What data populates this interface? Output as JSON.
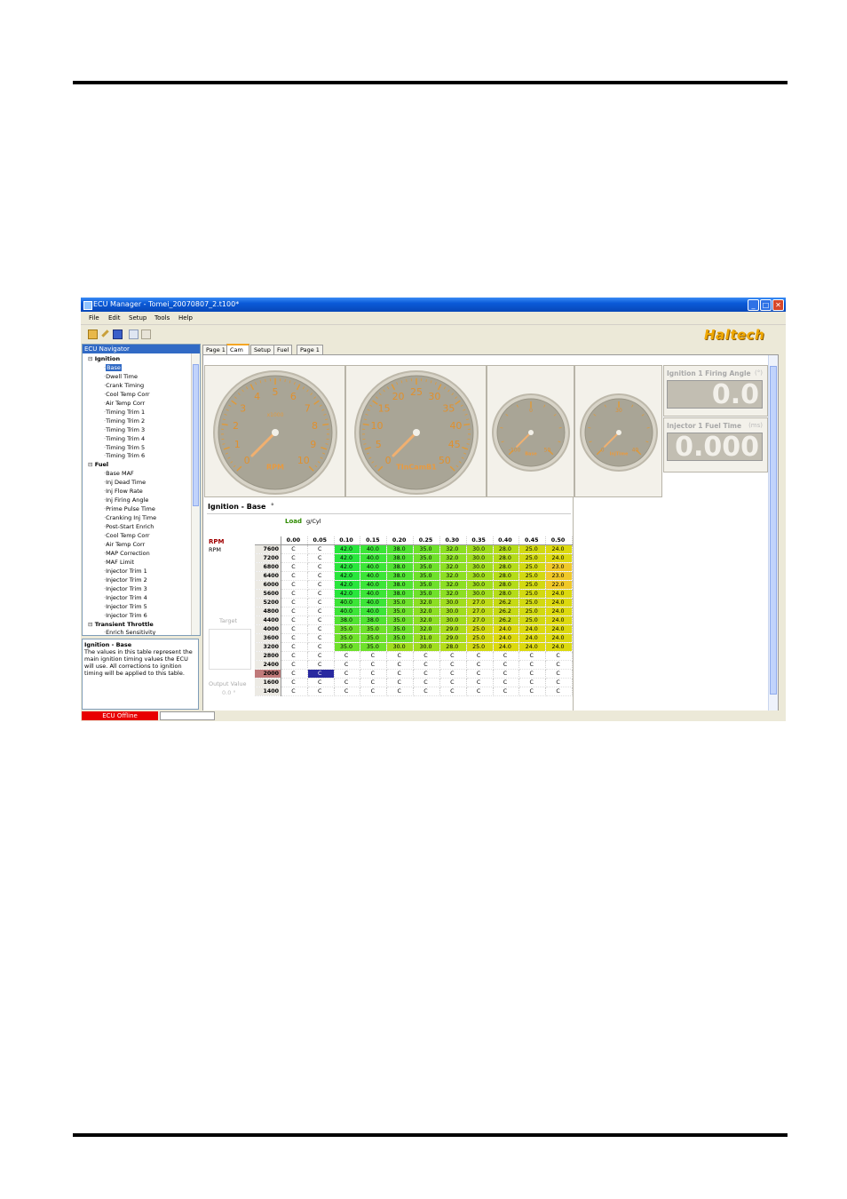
{
  "window": {
    "title": "ECU Manager - Tomei_20070807_2.t100*"
  },
  "menu": [
    "File",
    "Edit",
    "Setup",
    "Tools",
    "Help"
  ],
  "brand": {
    "logo": "Haltech"
  },
  "navigator": {
    "title": "ECU Navigator",
    "items": [
      {
        "label": "Ignition",
        "group": true
      },
      {
        "label": "Base",
        "selected": true
      },
      {
        "label": "Dwell Time"
      },
      {
        "label": "Crank Timing"
      },
      {
        "label": "Cool Temp Corr"
      },
      {
        "label": "Air Temp Corr"
      },
      {
        "label": "Timing Trim 1"
      },
      {
        "label": "Timing Trim 2"
      },
      {
        "label": "Timing Trim 3"
      },
      {
        "label": "Timing Trim 4"
      },
      {
        "label": "Timing Trim 5"
      },
      {
        "label": "Timing Trim 6"
      },
      {
        "label": "Fuel",
        "group": true
      },
      {
        "label": "Base MAF"
      },
      {
        "label": "Inj Dead Time"
      },
      {
        "label": "Inj Flow Rate"
      },
      {
        "label": "Inj Firing Angle"
      },
      {
        "label": "Prime Pulse Time"
      },
      {
        "label": "Cranking Inj Time"
      },
      {
        "label": "Post-Start Enrich"
      },
      {
        "label": "Cool Temp Corr"
      },
      {
        "label": "Air Temp Corr"
      },
      {
        "label": "MAP Correction"
      },
      {
        "label": "MAF Limit"
      },
      {
        "label": "Injector Trim 1"
      },
      {
        "label": "Injector Trim 2"
      },
      {
        "label": "Injector Trim 3"
      },
      {
        "label": "Injector Trim 4"
      },
      {
        "label": "Injector Trim 5"
      },
      {
        "label": "Injector Trim 6"
      },
      {
        "label": "Transient Throttle",
        "group": true
      },
      {
        "label": "Enrich Sensitivity"
      }
    ]
  },
  "description": {
    "title": "Ignition - Base",
    "text": "The values in this table represent the main ignition timing values the ECU will use. All corrections to ignition timing will be applied to this table."
  },
  "tabs": [
    "Page 1",
    "Cam",
    "Setup",
    "Fuel",
    "Page 1"
  ],
  "active_tab": 1,
  "gauges": [
    {
      "label": "RPM",
      "scale_label": "x1000",
      "ticks": [
        "0",
        "1",
        "2",
        "3",
        "4",
        "5",
        "6",
        "7",
        "8",
        "9",
        "10"
      ]
    },
    {
      "label": "TInCamB1",
      "ticks": [
        "0",
        "5",
        "10",
        "15",
        "20",
        "25",
        "30",
        "35",
        "40",
        "45",
        "50"
      ]
    },
    {
      "label": "Base",
      "ticks": [
        "-100",
        "0",
        "50"
      ]
    },
    {
      "label": "InjTime",
      "ticks": [
        "0",
        "30",
        "40"
      ]
    }
  ],
  "digital": [
    {
      "label": "Ignition 1 Firing Angle",
      "unit": "(°)",
      "value": "0.0"
    },
    {
      "label": "Injector 1 Fuel Time",
      "unit": "(ms)",
      "value": "0.000"
    }
  ],
  "table": {
    "title": "Ignition - Base",
    "unit_tab": "°",
    "load_label": "Load",
    "load_unit": "g/Cyl",
    "axis_label": "RPM",
    "axis_sub": "RPM",
    "target_label": "Target",
    "output_label": "Output Value",
    "output_value": "0.0 °",
    "columns": [
      "0.00",
      "0.05",
      "0.10",
      "0.15",
      "0.20",
      "0.25",
      "0.30",
      "0.35",
      "0.40",
      "0.45",
      "0.50"
    ],
    "rows": [
      {
        "rpm": "7600",
        "cells": [
          "C",
          "C",
          "42.0",
          "40.0",
          "38.0",
          "35.0",
          "32.0",
          "30.0",
          "28.0",
          "25.0",
          "24.0"
        ]
      },
      {
        "rpm": "7200",
        "cells": [
          "C",
          "C",
          "42.0",
          "40.0",
          "38.0",
          "35.0",
          "32.0",
          "30.0",
          "28.0",
          "25.0",
          "24.0"
        ]
      },
      {
        "rpm": "6800",
        "cells": [
          "C",
          "C",
          "42.0",
          "40.0",
          "38.0",
          "35.0",
          "32.0",
          "30.0",
          "28.0",
          "25.0",
          "23.0"
        ]
      },
      {
        "rpm": "6400",
        "cells": [
          "C",
          "C",
          "42.0",
          "40.0",
          "38.0",
          "35.0",
          "32.0",
          "30.0",
          "28.0",
          "25.0",
          "23.0"
        ]
      },
      {
        "rpm": "6000",
        "cells": [
          "C",
          "C",
          "42.0",
          "40.0",
          "38.0",
          "35.0",
          "32.0",
          "30.0",
          "28.0",
          "25.0",
          "22.0"
        ]
      },
      {
        "rpm": "5600",
        "cells": [
          "C",
          "C",
          "42.0",
          "40.0",
          "38.0",
          "35.0",
          "32.0",
          "30.0",
          "28.0",
          "25.0",
          "24.0"
        ]
      },
      {
        "rpm": "5200",
        "cells": [
          "C",
          "C",
          "40.0",
          "40.0",
          "35.0",
          "32.0",
          "30.0",
          "27.0",
          "26.2",
          "25.0",
          "24.0"
        ]
      },
      {
        "rpm": "4800",
        "cells": [
          "C",
          "C",
          "40.0",
          "40.0",
          "35.0",
          "32.0",
          "30.0",
          "27.0",
          "26.2",
          "25.0",
          "24.0"
        ]
      },
      {
        "rpm": "4400",
        "cells": [
          "C",
          "C",
          "38.0",
          "38.0",
          "35.0",
          "32.0",
          "30.0",
          "27.0",
          "26.2",
          "25.0",
          "24.0"
        ]
      },
      {
        "rpm": "4000",
        "cells": [
          "C",
          "C",
          "35.0",
          "35.0",
          "35.0",
          "32.0",
          "29.0",
          "25.0",
          "24.0",
          "24.0",
          "24.0"
        ]
      },
      {
        "rpm": "3600",
        "cells": [
          "C",
          "C",
          "35.0",
          "35.0",
          "35.0",
          "31.0",
          "29.0",
          "25.0",
          "24.0",
          "24.0",
          "24.0"
        ]
      },
      {
        "rpm": "3200",
        "cells": [
          "C",
          "C",
          "35.0",
          "35.0",
          "30.0",
          "30.0",
          "28.0",
          "25.0",
          "24.0",
          "24.0",
          "24.0"
        ]
      },
      {
        "rpm": "2800",
        "cells": [
          "C",
          "C",
          "C",
          "C",
          "C",
          "C",
          "C",
          "C",
          "C",
          "C",
          "C"
        ]
      },
      {
        "rpm": "2400",
        "cells": [
          "C",
          "C",
          "C",
          "C",
          "C",
          "C",
          "C",
          "C",
          "C",
          "C",
          "C"
        ]
      },
      {
        "rpm": "2000",
        "cells": [
          "C",
          "C",
          "C",
          "C",
          "C",
          "C",
          "C",
          "C",
          "C",
          "C",
          "C"
        ]
      },
      {
        "rpm": "1600",
        "cells": [
          "C",
          "C",
          "C",
          "C",
          "C",
          "C",
          "C",
          "C",
          "C",
          "C",
          "C"
        ]
      },
      {
        "rpm": "1400",
        "cells": [
          "C",
          "C",
          "C",
          "C",
          "C",
          "C",
          "C",
          "C",
          "C",
          "C",
          "C"
        ]
      }
    ],
    "highlight_column": 1,
    "highlight_row": 14
  },
  "status": {
    "ecu": "ECU Offline"
  }
}
